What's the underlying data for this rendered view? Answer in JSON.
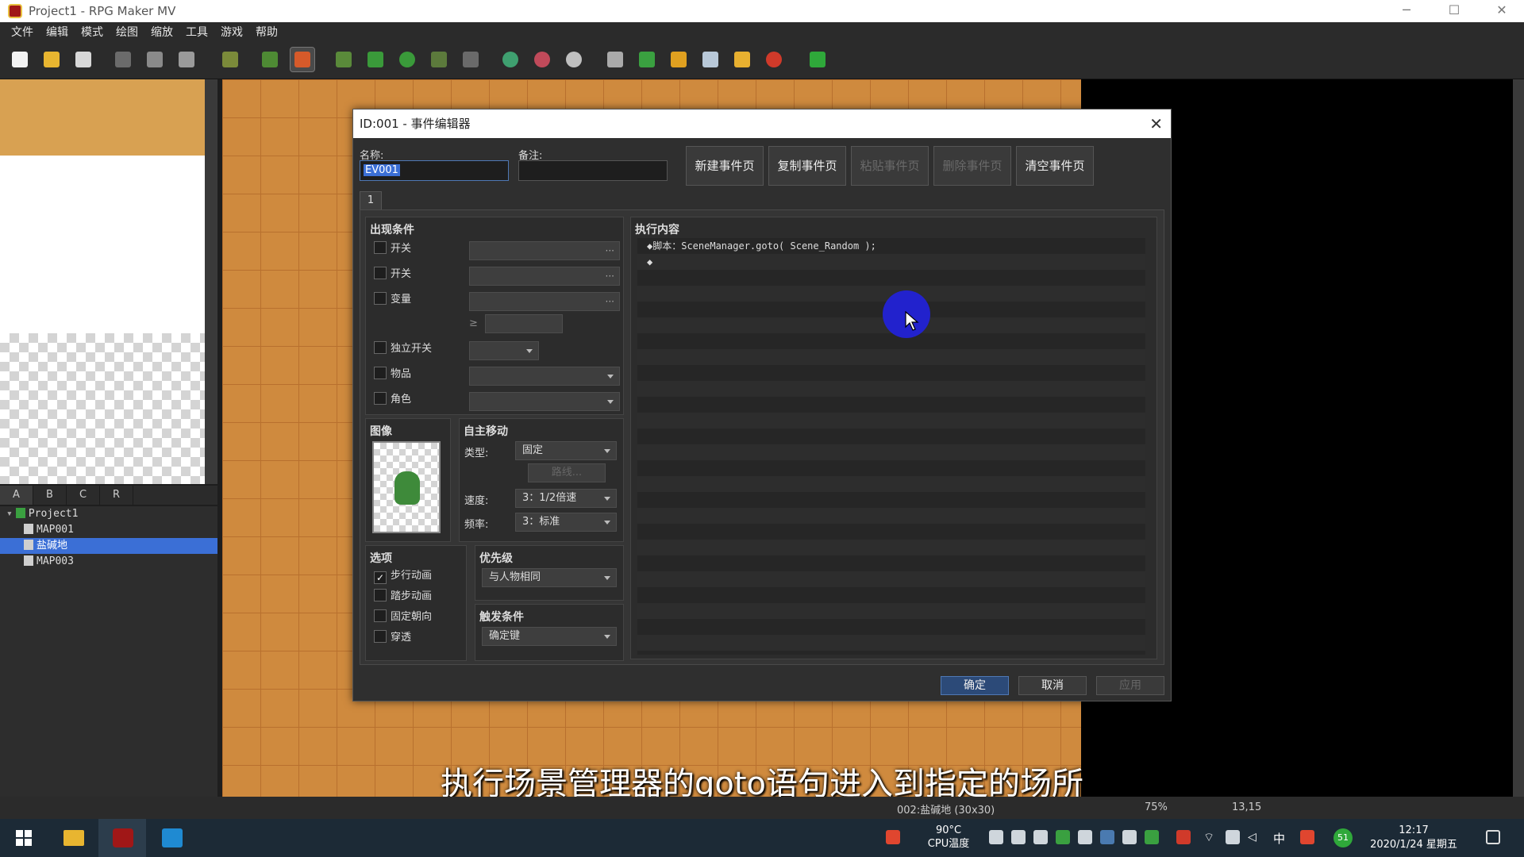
{
  "window": {
    "title": "Project1 - RPG Maker MV",
    "controls": [
      "─",
      "☐",
      "✕"
    ]
  },
  "menu": [
    "文件",
    "编辑",
    "模式",
    "绘图",
    "缩放",
    "工具",
    "游戏",
    "帮助"
  ],
  "toolbar": {
    "icons": [
      "new-project-icon",
      "open-folder-icon",
      "save-icon",
      "cut-icon",
      "copy-icon",
      "paste-icon",
      "undo-icon",
      "map-layer-icon",
      "event-layer-icon",
      "pencil-icon",
      "rectangle-icon",
      "ellipse-icon",
      "fill-icon",
      "shadow-pen-icon",
      "zoom-in-icon",
      "zoom-out-icon",
      "actual-size-icon",
      "database-icon",
      "plugin-manager-icon",
      "sound-test-icon",
      "event-searcher-icon",
      "resource-manager-icon",
      "character-generator-icon",
      "playtest-icon"
    ]
  },
  "tileset_tabs": [
    "A",
    "B",
    "C",
    "R"
  ],
  "map_tree": {
    "root": "Project1",
    "maps": [
      "MAP001",
      "盐碱地",
      "MAP003"
    ],
    "selected": "盐碱地"
  },
  "status": {
    "map": "002:盐碱地 (30x30)",
    "zoom": "75%",
    "coords": "13,15"
  },
  "subtitle": "执行场景管理器的goto语句进入到指定的场所",
  "dialog": {
    "title": "ID:001 - 事件编辑器",
    "name_label": "名称:",
    "name_value": "EV001",
    "note_label": "备注:",
    "note_value": "",
    "page_buttons": [
      "新建事件页",
      "复制事件页",
      "粘贴事件页",
      "删除事件页",
      "清空事件页"
    ],
    "page_tab": "1",
    "conditions": {
      "title": "出现条件",
      "items": [
        "开关",
        "开关",
        "变量",
        "独立开关",
        "物品",
        "角色"
      ],
      "var_op": "≥"
    },
    "image": {
      "title": "图像"
    },
    "autonomous": {
      "title": "自主移动",
      "type_label": "类型:",
      "type_value": "固定",
      "route_button": "路线...",
      "speed_label": "速度:",
      "speed_value": "3：1/2倍速",
      "freq_label": "频率:",
      "freq_value": "3：标准"
    },
    "options": {
      "title": "选项",
      "items": [
        {
          "label": "步行动画",
          "checked": "✓"
        },
        {
          "label": "踏步动画",
          "checked": ""
        },
        {
          "label": "固定朝向",
          "checked": ""
        },
        {
          "label": "穿透",
          "checked": ""
        }
      ]
    },
    "priority": {
      "title": "优先级",
      "value": "与人物相同"
    },
    "trigger": {
      "title": "触发条件",
      "value": "确定键"
    },
    "contents": {
      "title": "执行内容",
      "lines": [
        "◆脚本：SceneManager.goto( Scene_Random );",
        "◆"
      ]
    },
    "footer": [
      "确定",
      "取消",
      "应用"
    ]
  },
  "taskbar": {
    "cpu_temp": "90°C",
    "cpu_label": "CPU温度",
    "ime": "中",
    "time": "12:17",
    "date": "2020/1/24 星期五",
    "badge": "51"
  }
}
